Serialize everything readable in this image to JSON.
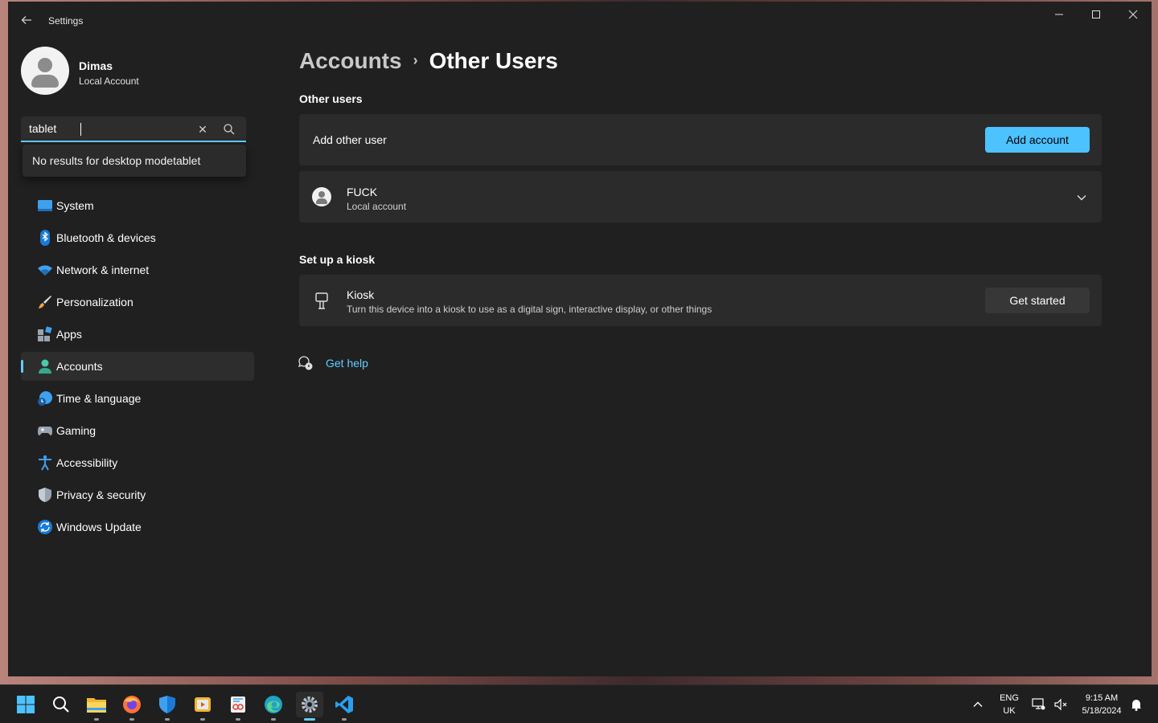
{
  "window": {
    "title": "Settings",
    "controls": {
      "minimize": "—",
      "maximize": "☐",
      "close": "✕"
    }
  },
  "profile": {
    "name": "Dimas",
    "type": "Local Account"
  },
  "search": {
    "value": "tablet",
    "clear_icon": "✕",
    "suggestion": "No results for desktop modetablet"
  },
  "sidebar": {
    "items": [
      {
        "label": "System",
        "icon": "system-icon",
        "active": false
      },
      {
        "label": "Bluetooth & devices",
        "icon": "bluetooth-icon",
        "active": false
      },
      {
        "label": "Network & internet",
        "icon": "wifi-icon",
        "active": false
      },
      {
        "label": "Personalization",
        "icon": "brush-icon",
        "active": false
      },
      {
        "label": "Apps",
        "icon": "apps-icon",
        "active": false
      },
      {
        "label": "Accounts",
        "icon": "person-icon",
        "active": true
      },
      {
        "label": "Time & language",
        "icon": "globe-clock-icon",
        "active": false
      },
      {
        "label": "Gaming",
        "icon": "gamepad-icon",
        "active": false
      },
      {
        "label": "Accessibility",
        "icon": "accessibility-icon",
        "active": false
      },
      {
        "label": "Privacy & security",
        "icon": "shield-icon",
        "active": false
      },
      {
        "label": "Windows Update",
        "icon": "sync-icon",
        "active": false
      }
    ]
  },
  "breadcrumb": {
    "parent": "Accounts",
    "separator": "›",
    "current": "Other Users"
  },
  "other_users": {
    "section_title": "Other users",
    "add_label": "Add other user",
    "add_button": "Add account",
    "user": {
      "name": "FUCK",
      "type": "Local account"
    }
  },
  "kiosk": {
    "section_title": "Set up a kiosk",
    "title": "Kiosk",
    "description": "Turn this device into a kiosk to use as a digital sign, interactive display, or other things",
    "button": "Get started"
  },
  "help": {
    "label": "Get help"
  },
  "taskbar": {
    "apps": [
      "start-icon",
      "search-icon",
      "file-explorer-icon",
      "firefox-icon",
      "defender-icon",
      "media-player-icon",
      "snipping-tool-icon",
      "edge-icon",
      "settings-icon",
      "vscode-icon"
    ],
    "language": {
      "line1": "ENG",
      "line2": "UK"
    },
    "clock": {
      "time": "9:15 AM",
      "date": "5/18/2024"
    }
  },
  "colors": {
    "accent": "#4cc2ff",
    "window_bg": "#202020",
    "card_bg": "#2b2b2b",
    "taskbar_bg": "#1f1f1f"
  }
}
